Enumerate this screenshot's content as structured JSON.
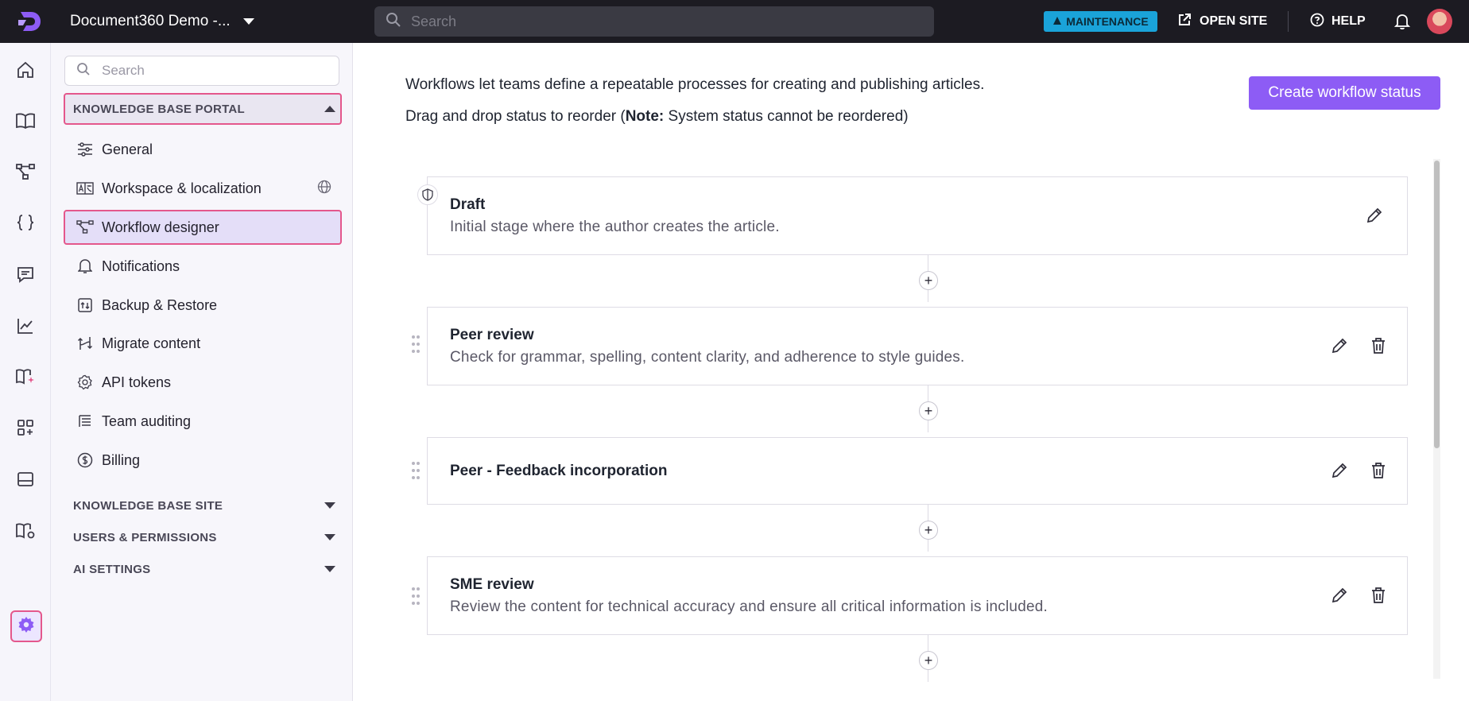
{
  "topbar": {
    "project_name": "Document360 Demo -...",
    "search_placeholder": "Search",
    "maintenance_label": "MAINTENANCE",
    "open_site_label": "OPEN SITE",
    "help_label": "HELP"
  },
  "rail": {
    "items": [
      "home-icon",
      "book-icon",
      "workflow-icon",
      "api-braces-icon",
      "feedback-icon",
      "analytics-icon",
      "ai-book-icon",
      "apps-add-icon",
      "widget-icon",
      "kb-settings-icon",
      "settings-icon"
    ],
    "active": "settings-icon"
  },
  "sidebar": {
    "search_placeholder": "Search",
    "portal_section": "KNOWLEDGE BASE PORTAL",
    "items": [
      {
        "label": "General",
        "icon": "sliders-icon"
      },
      {
        "label": "Workspace & localization",
        "icon": "localization-icon"
      },
      {
        "label": "Workflow designer",
        "icon": "workflow-icon"
      },
      {
        "label": "Notifications",
        "icon": "bell-icon"
      },
      {
        "label": "Backup & Restore",
        "icon": "backup-icon"
      },
      {
        "label": "Migrate content",
        "icon": "migrate-icon"
      },
      {
        "label": "API tokens",
        "icon": "api-token-icon"
      },
      {
        "label": "Team auditing",
        "icon": "audit-icon"
      },
      {
        "label": "Billing",
        "icon": "billing-icon"
      }
    ],
    "active_item": "Workflow designer",
    "sections": [
      {
        "label": "KNOWLEDGE BASE SITE"
      },
      {
        "label": "USERS & PERMISSIONS"
      },
      {
        "label": "AI SETTINGS"
      }
    ]
  },
  "main": {
    "intro_line1": "Workflows let teams define a repeatable processes for creating and publishing articles.",
    "intro_line2_prefix": "Drag and drop status to reorder (",
    "intro_line2_note": "Note:",
    "intro_line2_suffix": " System status cannot be reordered)",
    "create_button": "Create workflow status",
    "statuses": [
      {
        "title": "Draft",
        "description": "Initial stage where the author creates the article.",
        "system": true
      },
      {
        "title": "Peer review",
        "description": "Check for grammar, spelling, content clarity, and adherence to style guides.",
        "system": false
      },
      {
        "title": "Peer - Feedback incorporation",
        "description": "",
        "system": false
      },
      {
        "title": "SME review",
        "description": "Review the content for technical accuracy and ensure all critical information is included.",
        "system": false
      }
    ],
    "add_symbol": "+"
  },
  "colors": {
    "accent": "#8d5cf5",
    "highlight": "#e4578c",
    "maintenance": "#1aa3d9",
    "topbar": "#1c1b22"
  }
}
